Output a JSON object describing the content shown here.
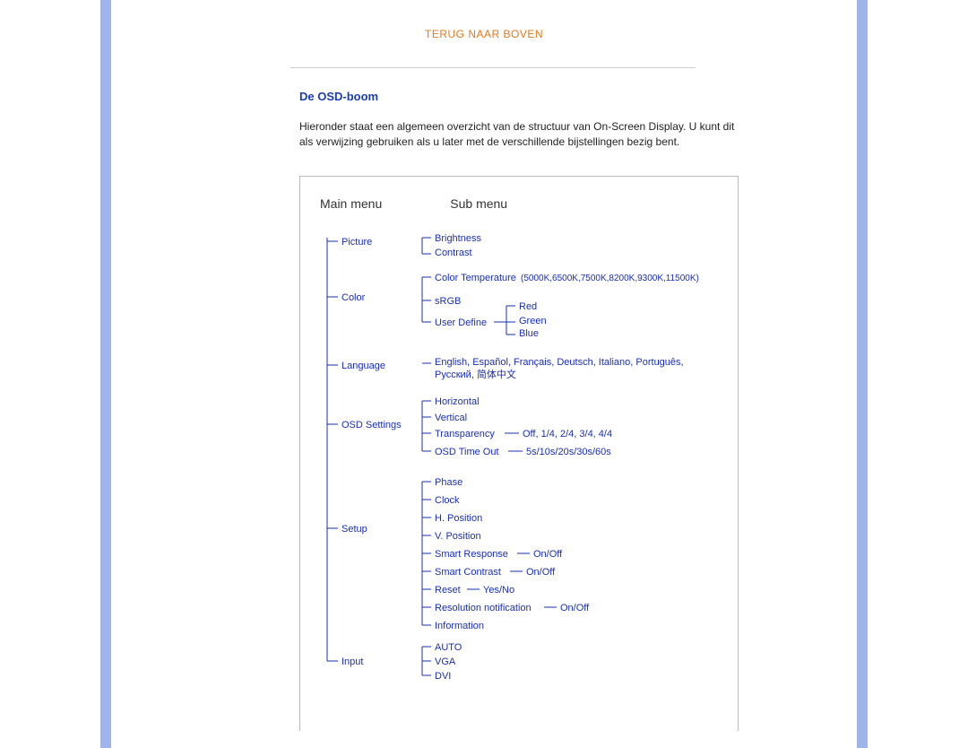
{
  "back_to_top": "TERUG NAAR BOVEN",
  "section_title": "De OSD-boom",
  "intro": "Hieronder staat een algemeen overzicht van de structuur van On-Screen Display. U kunt dit als verwijzing gebruiken als u later met de verschillende bijstellingen bezig bent.",
  "headers": {
    "main": "Main menu",
    "sub": "Sub menu"
  },
  "tree": {
    "picture": {
      "label": "Picture",
      "sub": {
        "brightness": "Brightness",
        "contrast": "Contrast"
      }
    },
    "color": {
      "label": "Color",
      "sub": {
        "color_temperature": "Color Temperature",
        "color_temperature_vals": "(5000K,6500K,7500K,8200K,9300K,11500K)",
        "srgb": "sRGB",
        "user_define": "User Define",
        "user_define_vals": {
          "red": "Red",
          "green": "Green",
          "blue": "Blue"
        }
      }
    },
    "language": {
      "label": "Language",
      "sub": {
        "line1": "English, Español, Français, Deutsch, Italiano, Português,",
        "line2": "Русский, 简体中文"
      }
    },
    "osd_settings": {
      "label": "OSD Settings",
      "sub": {
        "horizontal": "Horizontal",
        "vertical": "Vertical",
        "transparency": "Transparency",
        "transparency_vals": "Off, 1/4, 2/4, 3/4, 4/4",
        "osd_timeout": "OSD Time Out",
        "osd_timeout_vals": "5s/10s/20s/30s/60s"
      }
    },
    "setup": {
      "label": "Setup",
      "sub": {
        "phase": "Phase",
        "clock": "Clock",
        "h_position": "H. Position",
        "v_position": "V. Position",
        "smart_response": "Smart Response",
        "smart_response_vals": "On/Off",
        "smart_contrast": "Smart Contrast",
        "smart_contrast_vals": "On/Off",
        "reset": "Reset",
        "reset_vals": "Yes/No",
        "resolution_notification": "Resolution notification",
        "resolution_notification_vals": "On/Off",
        "information": "Information"
      }
    },
    "input": {
      "label": "Input",
      "sub": {
        "auto": "AUTO",
        "vga": "VGA",
        "dvi": "DVI"
      }
    }
  }
}
